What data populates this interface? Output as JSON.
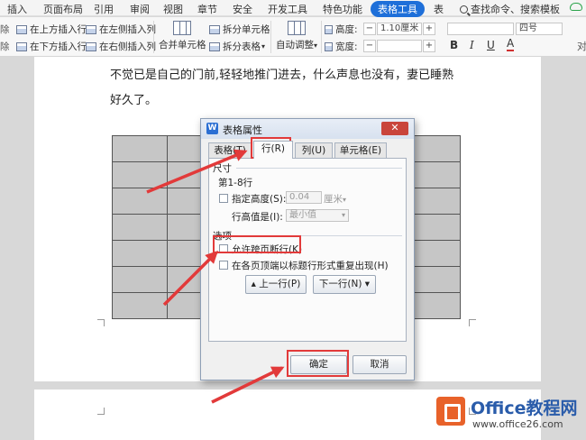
{
  "menubar": {
    "items": [
      "插入",
      "页面布局",
      "引用",
      "审阅",
      "视图",
      "章节",
      "安全",
      "开发工具",
      "特色功能",
      "表格工具",
      "表"
    ],
    "search": "查找命令、搜索模板"
  },
  "ribbon": {
    "insert_above": "在上方插入行",
    "insert_below": "在下方插入行",
    "insert_left": "在左侧插入列",
    "insert_right": "在右侧插入列",
    "merge_cells": "合并单元格",
    "split_cells": "拆分单元格",
    "split_table": "拆分表格",
    "auto_fit": "自动调整",
    "height_label": "高度:",
    "height_value": "1.10厘米",
    "width_label": "宽度:",
    "minus": "−",
    "plus": "+",
    "font_size": "四号",
    "bold": "B",
    "italic": "I",
    "underline": "U",
    "font_color": "A",
    "left_edge": "除",
    "right_edge": "对"
  },
  "document": {
    "line1": "不觉已是自己的门前,轻轻地推门进去，什么声息也没有，妻已睡熟",
    "line2": "好久了。"
  },
  "dialog": {
    "title": "表格属性",
    "close": "✕",
    "tabs": [
      "表格(T)",
      "行(R)",
      "列(U)",
      "单元格(E)"
    ],
    "size_group": "尺寸",
    "rows_label": "第1-8行",
    "specify_height": "指定高度(S):",
    "height_value": "0.04",
    "height_unit": "厘米",
    "row_height_is": "行高值是(I):",
    "row_height_mode": "最小值",
    "options_group": "选项",
    "allow_break": "允许跨页断行(K)",
    "repeat_header": "在各页顶端以标题行形式重复出现(H)",
    "prev_row": "上一行(P)",
    "next_row": "下一行(N)",
    "ok": "确定",
    "cancel": "取消"
  },
  "watermark": {
    "name": "Office教程网",
    "url": "www.office26.com"
  },
  "colors": {
    "accent": "#1e6fd9",
    "highlight": "#e23a3a",
    "logo_orange": "#e8622a",
    "logo_blue": "#2a5caa"
  }
}
